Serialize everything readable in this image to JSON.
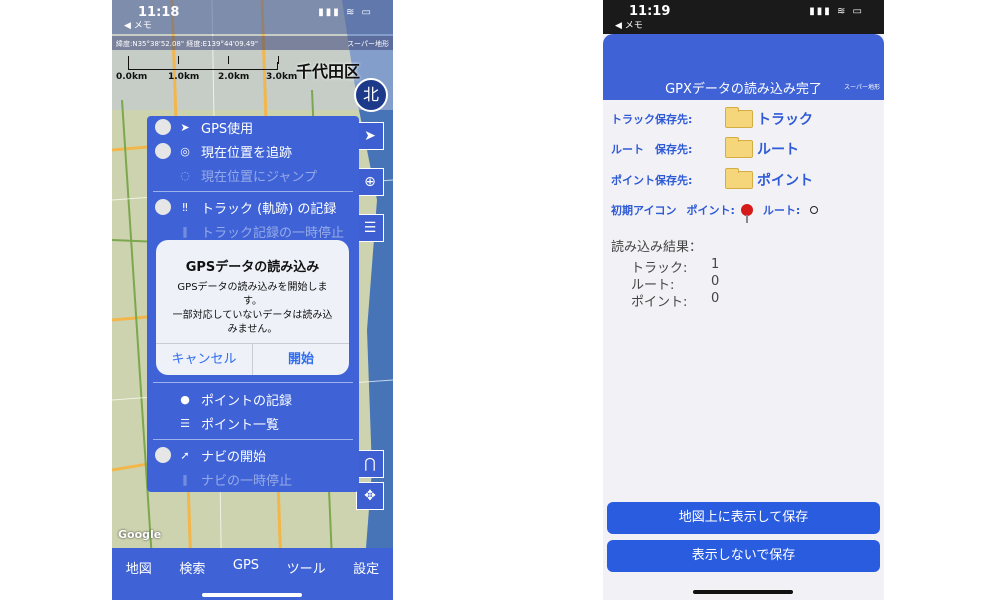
{
  "left": {
    "status": {
      "time": "11:18",
      "back": "◀ メモ",
      "signal": "▮▮▮ ≋ ▭"
    },
    "coords": "緯度:N35°38'52.08\" 経度:E139°44'09.49\"",
    "map_source": "スーパー地形",
    "scale": [
      "0.0km",
      "1.0km",
      "2.0km",
      "3.0km"
    ],
    "district": "千代田区",
    "compass": "北",
    "gps_menu": {
      "items": [
        {
          "label": "GPS使用",
          "icon": "➤",
          "toggle": true,
          "dim": false
        },
        {
          "label": "現在位置を追跡",
          "icon": "◎",
          "toggle": true,
          "dim": false
        },
        {
          "label": "現在位置にジャンプ",
          "icon": "◌",
          "toggle": false,
          "dim": true
        },
        {
          "label": "トラック (軌跡) の記録",
          "icon": "‼",
          "toggle": true,
          "dim": false
        },
        {
          "label": "トラック記録の一時停止",
          "icon": "‖",
          "toggle": false,
          "dim": true
        },
        {
          "label": "ポイントの記録",
          "icon": "●",
          "toggle": false,
          "dim": false
        },
        {
          "label": "ポイント一覧",
          "icon": "☰",
          "toggle": false,
          "dim": false
        },
        {
          "label": "ナビの開始",
          "icon": "➚",
          "toggle": true,
          "dim": false
        },
        {
          "label": "ナビの一時停止",
          "icon": "‖",
          "toggle": false,
          "dim": true
        }
      ]
    },
    "dialog": {
      "title": "GPSデータの読み込み",
      "message": "GPSデータの読み込みを開始します。\n一部対応していないデータは読み込みません。",
      "cancel": "キャンセル",
      "ok": "開始"
    },
    "google": "Google",
    "tabs": [
      "地図",
      "検索",
      "GPS",
      "ツール",
      "設定"
    ]
  },
  "right": {
    "status": {
      "time": "11:19",
      "back": "◀ メモ",
      "signal": "▮▮▮ ≋ ▭"
    },
    "title": "GPXデータの読み込み完了",
    "map_source": "スーパー地形",
    "rows": [
      {
        "label": "トラック保存先:",
        "value": "トラック"
      },
      {
        "label": "ルート　保存先:",
        "value": "ルート"
      },
      {
        "label": "ポイント保存先:",
        "value": "ポイント"
      }
    ],
    "icon_row": {
      "label": "初期アイコン",
      "point": "ポイント:",
      "route": "ルート:"
    },
    "results": {
      "title": "読み込み結果：",
      "lines": [
        {
          "key": "トラック:",
          "val": "1"
        },
        {
          "key": "ルート:",
          "val": "0"
        },
        {
          "key": "ポイント:",
          "val": "0"
        }
      ]
    },
    "buttons": {
      "save_show": "地図上に表示して保存",
      "save_hide": "表示しないで保存"
    }
  }
}
